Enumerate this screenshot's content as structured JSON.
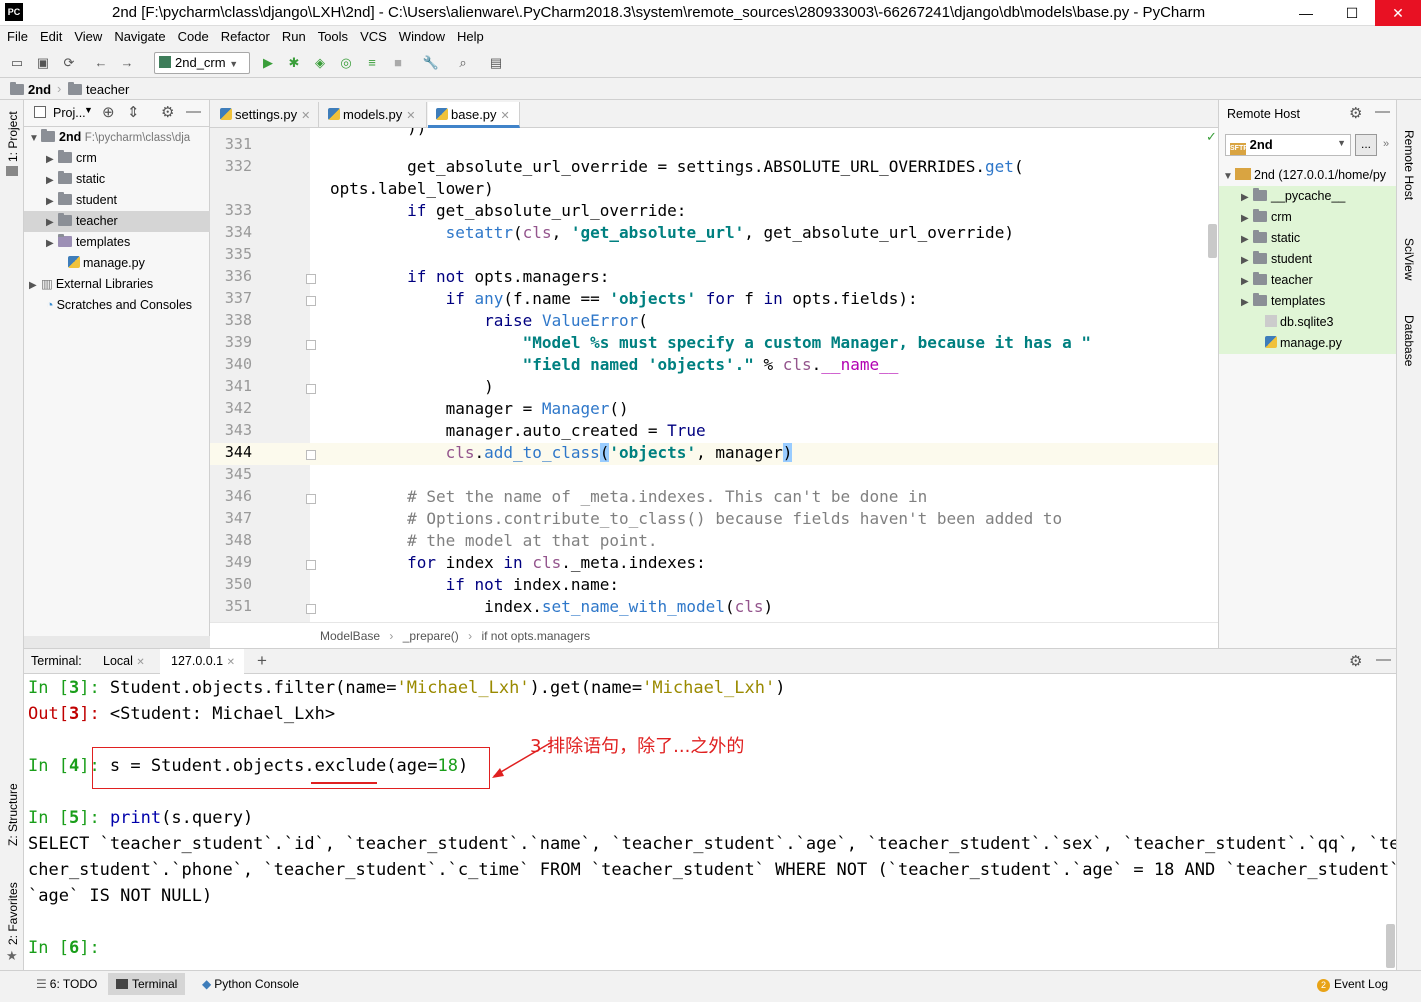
{
  "window": {
    "app_icon": "PC",
    "title": "2nd [F:\\pycharm\\class\\django\\LXH\\2nd] - C:\\Users\\alienware\\.PyCharm2018.3\\system\\remote_sources\\280933003\\-66267241\\django\\db\\models\\base.py - PyCharm",
    "minimize": "—",
    "maximize": "☐",
    "close": "✕"
  },
  "menu": [
    "File",
    "Edit",
    "View",
    "Navigate",
    "Code",
    "Refactor",
    "Run",
    "Tools",
    "VCS",
    "Window",
    "Help"
  ],
  "toolbar": {
    "run_config": "2nd_crm"
  },
  "navbar": {
    "project": "2nd",
    "folder": "teacher"
  },
  "left_strip": {
    "project": "1: Project",
    "structure": "Z: Structure",
    "favorites": "2: Favorites"
  },
  "right_strip": {
    "remote_host": "Remote Host",
    "sciview": "SciView",
    "database": "Database"
  },
  "project_panel": {
    "header": "Proj...",
    "root": {
      "name": "2nd",
      "path": "F:\\pycharm\\class\\dja"
    },
    "items": [
      {
        "label": "crm"
      },
      {
        "label": "static"
      },
      {
        "label": "student"
      },
      {
        "label": "teacher"
      },
      {
        "label": "templates"
      },
      {
        "label": "manage.py"
      }
    ],
    "external": "External Libraries",
    "scratches": "Scratches and Consoles"
  },
  "tabs": [
    {
      "label": "settings.py"
    },
    {
      "label": "models.py"
    },
    {
      "label": "base.py"
    }
  ],
  "editor": {
    "line_numbers": [
      "331",
      "332",
      "",
      "333",
      "334",
      "335",
      "336",
      "337",
      "338",
      "339",
      "340",
      "341",
      "342",
      "343",
      "344",
      "345",
      "346",
      "347",
      "348",
      "349",
      "350",
      "351"
    ],
    "highlighted_line": "344"
  },
  "breadcrumb": [
    "ModelBase",
    "_prepare()",
    "if not opts.managers"
  ],
  "remote_host": {
    "title": "Remote Host",
    "server": "2nd",
    "browse": "...",
    "root": "2nd (127.0.0.1/home/py",
    "items": [
      "__pycache__",
      "crm",
      "static",
      "student",
      "teacher",
      "templates",
      "db.sqlite3",
      "manage.py"
    ]
  },
  "terminal": {
    "label": "Terminal:",
    "tabs": [
      "Local",
      "127.0.0.1"
    ],
    "add": "+",
    "annotation": "3.排除语句，除了...之外的",
    "sql_lines": [
      "SELECT `teacher_student`.`id`, `teacher_student`.`name`, `teacher_student`.`age`, `teacher_student`.`sex`, `teacher_student`.`qq`, `tea",
      "cher_student`.`phone`, `teacher_student`.`c_time` FROM `teacher_student` WHERE NOT (`teacher_student`.`age` = 18 AND `teacher_student`.",
      "`age` IS NOT NULL)"
    ]
  },
  "bottom_tabs": [
    {
      "label": "6: TODO"
    },
    {
      "label": "Terminal"
    },
    {
      "label": "Python Console"
    }
  ],
  "event_log": {
    "count": "2",
    "label": "Event Log"
  }
}
